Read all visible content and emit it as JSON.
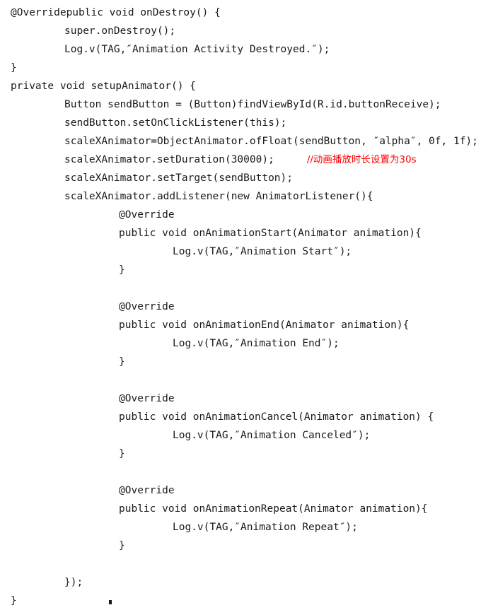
{
  "document": {
    "kind": "source-code-listing",
    "language": "Java",
    "background_color": "#ffffff",
    "text_color": "#1a1a1a",
    "comment_color": "#ff0000"
  },
  "code": {
    "lines": [
      {
        "indent": 0,
        "text": "@Overridepublic void onDestroy() {"
      },
      {
        "indent": 1,
        "text": "super.onDestroy();"
      },
      {
        "indent": 1,
        "text": "Log.v(TAG,″Animation Activity Destroyed.″);"
      },
      {
        "indent": 0,
        "text": "}"
      },
      {
        "indent": 0,
        "text": "private void setupAnimator() {"
      },
      {
        "indent": 1,
        "text": "Button sendButton = (Button)findViewById(R.id.buttonReceive);"
      },
      {
        "indent": 1,
        "text": "sendButton.setOnClickListener(this);"
      },
      {
        "indent": 1,
        "text": "scaleXAnimator=ObjectAnimator.ofFloat(sendButton, ″alpha″, 0f, 1f);"
      },
      {
        "indent": 1,
        "text": "scaleXAnimator.setDuration(30000);",
        "comment": "//动画播放时长设置为30s"
      },
      {
        "indent": 1,
        "text": "scaleXAnimator.setTarget(sendButton);"
      },
      {
        "indent": 1,
        "text": "scaleXAnimator.addListener(new AnimatorListener(){"
      },
      {
        "indent": 2,
        "text": "@Override"
      },
      {
        "indent": 2,
        "text": "public void onAnimationStart(Animator animation){"
      },
      {
        "indent": 3,
        "text": "Log.v(TAG,″Animation Start″);"
      },
      {
        "indent": 2,
        "text": "}"
      },
      {
        "indent": 2,
        "text": ""
      },
      {
        "indent": 2,
        "text": "@Override"
      },
      {
        "indent": 2,
        "text": "public void onAnimationEnd(Animator animation){"
      },
      {
        "indent": 3,
        "text": "Log.v(TAG,″Animation End″);"
      },
      {
        "indent": 2,
        "text": "}"
      },
      {
        "indent": 2,
        "text": ""
      },
      {
        "indent": 2,
        "text": "@Override"
      },
      {
        "indent": 2,
        "text": "public void onAnimationCancel(Animator animation) {"
      },
      {
        "indent": 3,
        "text": "Log.v(TAG,″Animation Canceled″);"
      },
      {
        "indent": 2,
        "text": "}"
      },
      {
        "indent": 2,
        "text": ""
      },
      {
        "indent": 2,
        "text": "@Override"
      },
      {
        "indent": 2,
        "text": "public void onAnimationRepeat(Animator animation){"
      },
      {
        "indent": 3,
        "text": "Log.v(TAG,″Animation Repeat″);"
      },
      {
        "indent": 2,
        "text": "}"
      },
      {
        "indent": 2,
        "text": ""
      },
      {
        "indent": 1,
        "text": "});"
      },
      {
        "indent": 0,
        "text": "}"
      }
    ]
  }
}
